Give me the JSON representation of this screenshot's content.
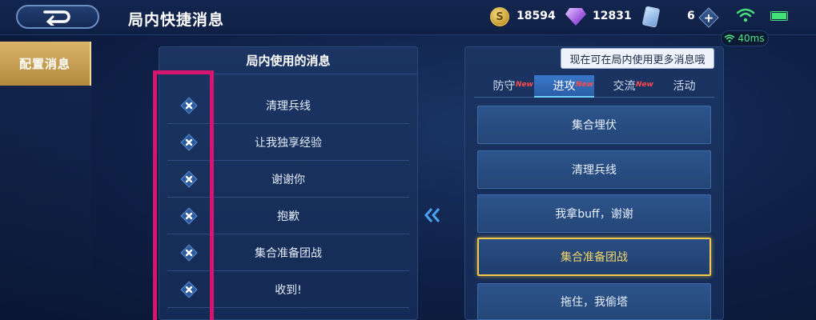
{
  "header": {
    "title": "局内快捷消息",
    "gold": "18594",
    "diamonds": "12831",
    "cards": "6",
    "ping": "40ms"
  },
  "sidebar": {
    "active_tab": "配置消息"
  },
  "left_panel": {
    "title": "局内使用的消息",
    "messages": [
      "清理兵线",
      "让我独享经验",
      "谢谢你",
      "抱歉",
      "集合准备团战",
      "收到!"
    ]
  },
  "right_panel": {
    "tooltip": "现在可在局内使用更多消息哦",
    "tabs": [
      {
        "label": "防守",
        "new": "New"
      },
      {
        "label": "进攻",
        "new": "New"
      },
      {
        "label": "交流",
        "new": "New"
      },
      {
        "label": "活动",
        "new": ""
      }
    ],
    "active_tab": "进攻",
    "options": [
      "集合埋伏",
      "清理兵线",
      "我拿buff，谢谢",
      "集合准备团战",
      "拖住，我偷塔"
    ],
    "selected_option": "集合准备团战"
  },
  "colors": {
    "highlight_box": "#d8156e",
    "selected_border": "#f2c84b",
    "ping": "#4fe37d"
  }
}
